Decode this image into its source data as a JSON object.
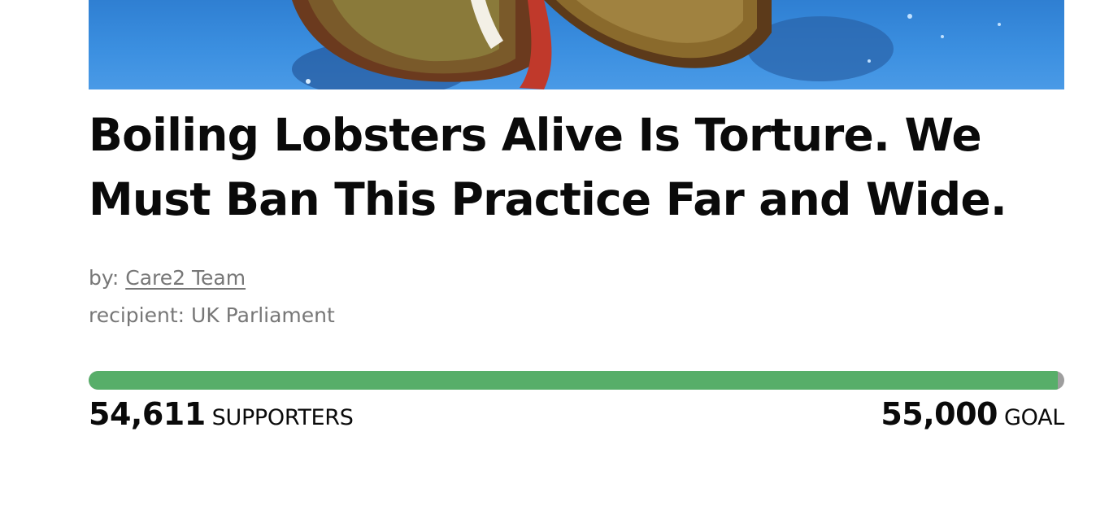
{
  "petition": {
    "title": "Boiling Lobsters Alive Is Torture. We Must Ban This Practice Far and Wide.",
    "by_label": "by:",
    "author": "Care2 Team",
    "recipient_label": "recipient:",
    "recipient": "UK Parliament",
    "supporters_count": "54,611",
    "supporters_label": "SUPPORTERS",
    "goal_count": "55,000",
    "goal_label": "GOAL",
    "progress_fraction": 0.993
  },
  "colors": {
    "progress_fill": "#57ae69",
    "progress_track": "#9e9e9e",
    "meta_text": "#777777",
    "title_text": "#0a0a0a"
  }
}
